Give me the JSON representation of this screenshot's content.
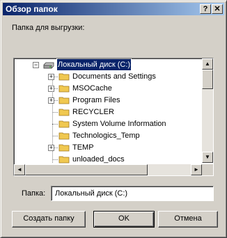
{
  "window": {
    "title": "Обзор папок",
    "help_glyph": "?",
    "close_glyph": "✕"
  },
  "prompt_label": "Папка для выгрузки:",
  "tree": {
    "root": {
      "label": "Локальный диск (C:)",
      "icon": "drive-icon",
      "expanded": true,
      "selected": true
    },
    "items": [
      {
        "label": "Documents and Settings",
        "icon": "folder-icon",
        "expandable": true
      },
      {
        "label": "MSOCache",
        "icon": "folder-icon",
        "expandable": true
      },
      {
        "label": "Program Files",
        "icon": "folder-icon",
        "expandable": true
      },
      {
        "label": "RECYCLER",
        "icon": "folder-icon",
        "expandable": false
      },
      {
        "label": "System Volume Information",
        "icon": "folder-icon",
        "expandable": false
      },
      {
        "label": "Technologics_Temp",
        "icon": "folder-icon",
        "expandable": false
      },
      {
        "label": "TEMP",
        "icon": "folder-icon",
        "expandable": true
      },
      {
        "label": "unloaded_docs",
        "icon": "folder-icon",
        "expandable": false
      }
    ]
  },
  "folder_field": {
    "label": "Папка:",
    "value": "Локальный диск (C:)"
  },
  "buttons": {
    "new_folder": "Создать папку",
    "ok": "OK",
    "cancel": "Отмена"
  },
  "colors": {
    "selection": "#0a246a",
    "face": "#d4d0c8",
    "folder": "#f0c850"
  }
}
